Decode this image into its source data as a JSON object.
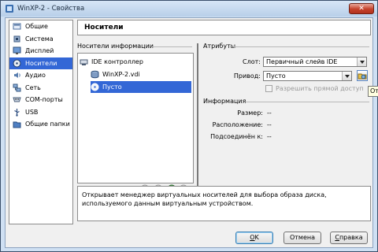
{
  "window": {
    "title": "WinXP-2 - Свойства",
    "close_glyph": "✕"
  },
  "sidebar": {
    "items": [
      {
        "label": "Общие",
        "icon": "general-icon"
      },
      {
        "label": "Система",
        "icon": "system-icon"
      },
      {
        "label": "Дисплей",
        "icon": "display-icon"
      },
      {
        "label": "Носители",
        "icon": "storage-icon",
        "selected": true
      },
      {
        "label": "Аудио",
        "icon": "audio-icon"
      },
      {
        "label": "Сеть",
        "icon": "network-icon"
      },
      {
        "label": "COM-порты",
        "icon": "serial-ports-icon"
      },
      {
        "label": "USB",
        "icon": "usb-icon"
      },
      {
        "label": "Общие папки",
        "icon": "shared-folders-icon"
      }
    ]
  },
  "page": {
    "title": "Носители"
  },
  "storage_tree": {
    "label": "Носители информации",
    "controller": "IDE контроллер",
    "attachments": [
      {
        "label": "WinXP-2.vdi",
        "icon": "hard-disk-icon"
      },
      {
        "label": "Пусто",
        "icon": "cd-empty-icon",
        "selected": true
      }
    ]
  },
  "attributes": {
    "label": "Атрибуты",
    "slot_label": "Слот:",
    "slot_value": "Первичный слейв IDE",
    "drive_label": "Привод:",
    "drive_value": "Пусто",
    "passthrough_label": "Разрешить прямой доступ",
    "passthrough_checked": false
  },
  "information": {
    "label": "Информация",
    "size_label": "Размер:",
    "size_value": "--",
    "location_label": "Расположение:",
    "location_value": "--",
    "attached_label": "Подсоединён к:",
    "attached_value": "--"
  },
  "tooltip": {
    "text": "От"
  },
  "description": "Открывает менеджер виртуальных носителей для выбора образа диска, используемого данным виртуальным устройством.",
  "buttons": {
    "ok_first": "O",
    "ok_rest": "K",
    "cancel": "Отмена",
    "help_first": "С",
    "help_rest": "правка"
  },
  "colors": {
    "selection": "#3367d6",
    "window_frame": "#cfe0f3"
  }
}
